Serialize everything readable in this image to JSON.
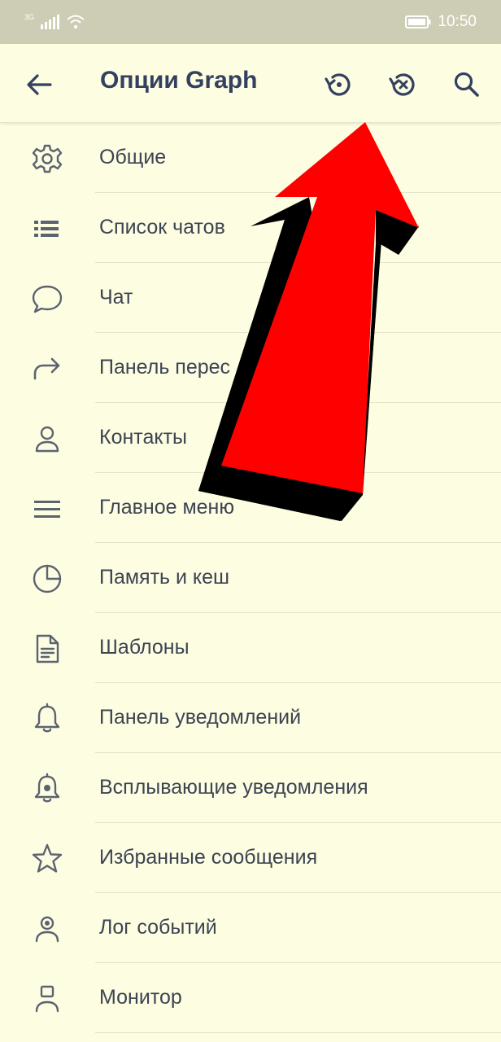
{
  "status_bar": {
    "network": "3G",
    "time": "10:50"
  },
  "app_bar": {
    "title": "Опции Graph",
    "icons": {
      "back": "arrow-left-icon",
      "restore": "restore-icon",
      "reset": "history-clear-icon",
      "search": "search-icon"
    }
  },
  "menu": {
    "items": [
      {
        "label": "Общие",
        "icon": "gear-icon"
      },
      {
        "label": "Список чатов",
        "icon": "list-icon"
      },
      {
        "label": "Чат",
        "icon": "chat-bubble-icon"
      },
      {
        "label": "Панель перес",
        "icon": "forward-icon"
      },
      {
        "label": "Контакты",
        "icon": "person-icon"
      },
      {
        "label": "Главное меню",
        "icon": "menu-icon"
      },
      {
        "label": "Память и кеш",
        "icon": "pie-chart-icon"
      },
      {
        "label": "Шаблоны",
        "icon": "document-icon"
      },
      {
        "label": "Панель уведомлений",
        "icon": "bell-icon"
      },
      {
        "label": "Всплывающие уведомления",
        "icon": "bell-dot-icon"
      },
      {
        "label": "Избранные сообщения",
        "icon": "star-icon"
      },
      {
        "label": "Лог событий",
        "icon": "person-log-icon"
      },
      {
        "label": "Монитор",
        "icon": "monitor-person-icon"
      }
    ]
  },
  "overlay": {
    "arrow_color": "#ff0000",
    "shadow_color": "#000000"
  },
  "colors": {
    "background": "#fdfde2",
    "status_bar": "#cdcdb5",
    "title": "#34405f",
    "icon": "#5c6370"
  }
}
